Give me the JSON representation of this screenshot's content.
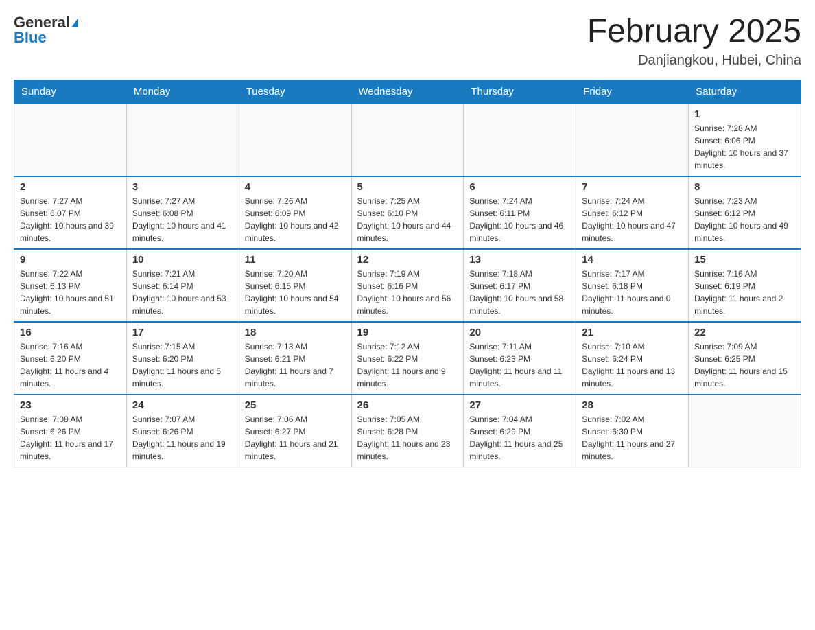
{
  "header": {
    "logo_general": "General",
    "logo_blue": "Blue",
    "month_title": "February 2025",
    "location": "Danjiangkou, Hubei, China"
  },
  "days_of_week": [
    "Sunday",
    "Monday",
    "Tuesday",
    "Wednesday",
    "Thursday",
    "Friday",
    "Saturday"
  ],
  "weeks": [
    [
      {
        "day": "",
        "sunrise": "",
        "sunset": "",
        "daylight": "",
        "empty": true
      },
      {
        "day": "",
        "sunrise": "",
        "sunset": "",
        "daylight": "",
        "empty": true
      },
      {
        "day": "",
        "sunrise": "",
        "sunset": "",
        "daylight": "",
        "empty": true
      },
      {
        "day": "",
        "sunrise": "",
        "sunset": "",
        "daylight": "",
        "empty": true
      },
      {
        "day": "",
        "sunrise": "",
        "sunset": "",
        "daylight": "",
        "empty": true
      },
      {
        "day": "",
        "sunrise": "",
        "sunset": "",
        "daylight": "",
        "empty": true
      },
      {
        "day": "1",
        "sunrise": "Sunrise: 7:28 AM",
        "sunset": "Sunset: 6:06 PM",
        "daylight": "Daylight: 10 hours and 37 minutes.",
        "empty": false
      }
    ],
    [
      {
        "day": "2",
        "sunrise": "Sunrise: 7:27 AM",
        "sunset": "Sunset: 6:07 PM",
        "daylight": "Daylight: 10 hours and 39 minutes.",
        "empty": false
      },
      {
        "day": "3",
        "sunrise": "Sunrise: 7:27 AM",
        "sunset": "Sunset: 6:08 PM",
        "daylight": "Daylight: 10 hours and 41 minutes.",
        "empty": false
      },
      {
        "day": "4",
        "sunrise": "Sunrise: 7:26 AM",
        "sunset": "Sunset: 6:09 PM",
        "daylight": "Daylight: 10 hours and 42 minutes.",
        "empty": false
      },
      {
        "day": "5",
        "sunrise": "Sunrise: 7:25 AM",
        "sunset": "Sunset: 6:10 PM",
        "daylight": "Daylight: 10 hours and 44 minutes.",
        "empty": false
      },
      {
        "day": "6",
        "sunrise": "Sunrise: 7:24 AM",
        "sunset": "Sunset: 6:11 PM",
        "daylight": "Daylight: 10 hours and 46 minutes.",
        "empty": false
      },
      {
        "day": "7",
        "sunrise": "Sunrise: 7:24 AM",
        "sunset": "Sunset: 6:12 PM",
        "daylight": "Daylight: 10 hours and 47 minutes.",
        "empty": false
      },
      {
        "day": "8",
        "sunrise": "Sunrise: 7:23 AM",
        "sunset": "Sunset: 6:12 PM",
        "daylight": "Daylight: 10 hours and 49 minutes.",
        "empty": false
      }
    ],
    [
      {
        "day": "9",
        "sunrise": "Sunrise: 7:22 AM",
        "sunset": "Sunset: 6:13 PM",
        "daylight": "Daylight: 10 hours and 51 minutes.",
        "empty": false
      },
      {
        "day": "10",
        "sunrise": "Sunrise: 7:21 AM",
        "sunset": "Sunset: 6:14 PM",
        "daylight": "Daylight: 10 hours and 53 minutes.",
        "empty": false
      },
      {
        "day": "11",
        "sunrise": "Sunrise: 7:20 AM",
        "sunset": "Sunset: 6:15 PM",
        "daylight": "Daylight: 10 hours and 54 minutes.",
        "empty": false
      },
      {
        "day": "12",
        "sunrise": "Sunrise: 7:19 AM",
        "sunset": "Sunset: 6:16 PM",
        "daylight": "Daylight: 10 hours and 56 minutes.",
        "empty": false
      },
      {
        "day": "13",
        "sunrise": "Sunrise: 7:18 AM",
        "sunset": "Sunset: 6:17 PM",
        "daylight": "Daylight: 10 hours and 58 minutes.",
        "empty": false
      },
      {
        "day": "14",
        "sunrise": "Sunrise: 7:17 AM",
        "sunset": "Sunset: 6:18 PM",
        "daylight": "Daylight: 11 hours and 0 minutes.",
        "empty": false
      },
      {
        "day": "15",
        "sunrise": "Sunrise: 7:16 AM",
        "sunset": "Sunset: 6:19 PM",
        "daylight": "Daylight: 11 hours and 2 minutes.",
        "empty": false
      }
    ],
    [
      {
        "day": "16",
        "sunrise": "Sunrise: 7:16 AM",
        "sunset": "Sunset: 6:20 PM",
        "daylight": "Daylight: 11 hours and 4 minutes.",
        "empty": false
      },
      {
        "day": "17",
        "sunrise": "Sunrise: 7:15 AM",
        "sunset": "Sunset: 6:20 PM",
        "daylight": "Daylight: 11 hours and 5 minutes.",
        "empty": false
      },
      {
        "day": "18",
        "sunrise": "Sunrise: 7:13 AM",
        "sunset": "Sunset: 6:21 PM",
        "daylight": "Daylight: 11 hours and 7 minutes.",
        "empty": false
      },
      {
        "day": "19",
        "sunrise": "Sunrise: 7:12 AM",
        "sunset": "Sunset: 6:22 PM",
        "daylight": "Daylight: 11 hours and 9 minutes.",
        "empty": false
      },
      {
        "day": "20",
        "sunrise": "Sunrise: 7:11 AM",
        "sunset": "Sunset: 6:23 PM",
        "daylight": "Daylight: 11 hours and 11 minutes.",
        "empty": false
      },
      {
        "day": "21",
        "sunrise": "Sunrise: 7:10 AM",
        "sunset": "Sunset: 6:24 PM",
        "daylight": "Daylight: 11 hours and 13 minutes.",
        "empty": false
      },
      {
        "day": "22",
        "sunrise": "Sunrise: 7:09 AM",
        "sunset": "Sunset: 6:25 PM",
        "daylight": "Daylight: 11 hours and 15 minutes.",
        "empty": false
      }
    ],
    [
      {
        "day": "23",
        "sunrise": "Sunrise: 7:08 AM",
        "sunset": "Sunset: 6:26 PM",
        "daylight": "Daylight: 11 hours and 17 minutes.",
        "empty": false
      },
      {
        "day": "24",
        "sunrise": "Sunrise: 7:07 AM",
        "sunset": "Sunset: 6:26 PM",
        "daylight": "Daylight: 11 hours and 19 minutes.",
        "empty": false
      },
      {
        "day": "25",
        "sunrise": "Sunrise: 7:06 AM",
        "sunset": "Sunset: 6:27 PM",
        "daylight": "Daylight: 11 hours and 21 minutes.",
        "empty": false
      },
      {
        "day": "26",
        "sunrise": "Sunrise: 7:05 AM",
        "sunset": "Sunset: 6:28 PM",
        "daylight": "Daylight: 11 hours and 23 minutes.",
        "empty": false
      },
      {
        "day": "27",
        "sunrise": "Sunrise: 7:04 AM",
        "sunset": "Sunset: 6:29 PM",
        "daylight": "Daylight: 11 hours and 25 minutes.",
        "empty": false
      },
      {
        "day": "28",
        "sunrise": "Sunrise: 7:02 AM",
        "sunset": "Sunset: 6:30 PM",
        "daylight": "Daylight: 11 hours and 27 minutes.",
        "empty": false
      },
      {
        "day": "",
        "sunrise": "",
        "sunset": "",
        "daylight": "",
        "empty": true
      }
    ]
  ]
}
